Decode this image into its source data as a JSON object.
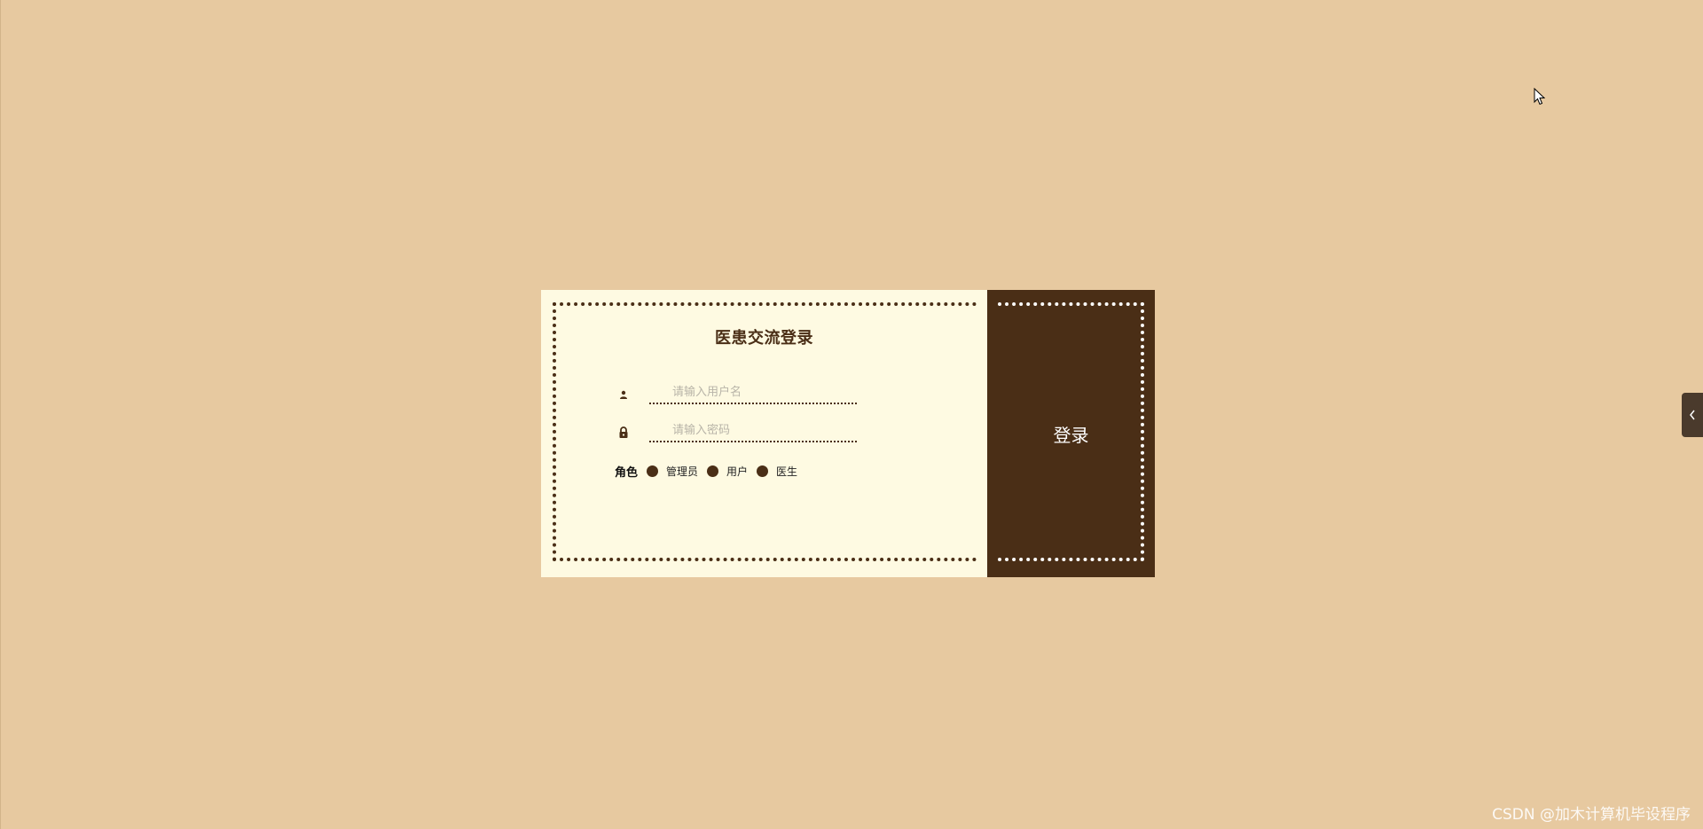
{
  "login": {
    "title": "医患交流登录",
    "username_placeholder": "请输入用户名",
    "password_placeholder": "请输入密码",
    "role_label": "角色",
    "roles": [
      "管理员",
      "用户",
      "医生"
    ],
    "submit_label": "登录"
  },
  "icons": {
    "username": "user-icon",
    "password": "lock-icon",
    "side_tab": "chevron-left-icon"
  },
  "colors": {
    "background": "#e7c9a0",
    "panel": "#fefae2",
    "accent": "#4a2e16"
  },
  "watermark": "CSDN @加木计算机毕设程序"
}
